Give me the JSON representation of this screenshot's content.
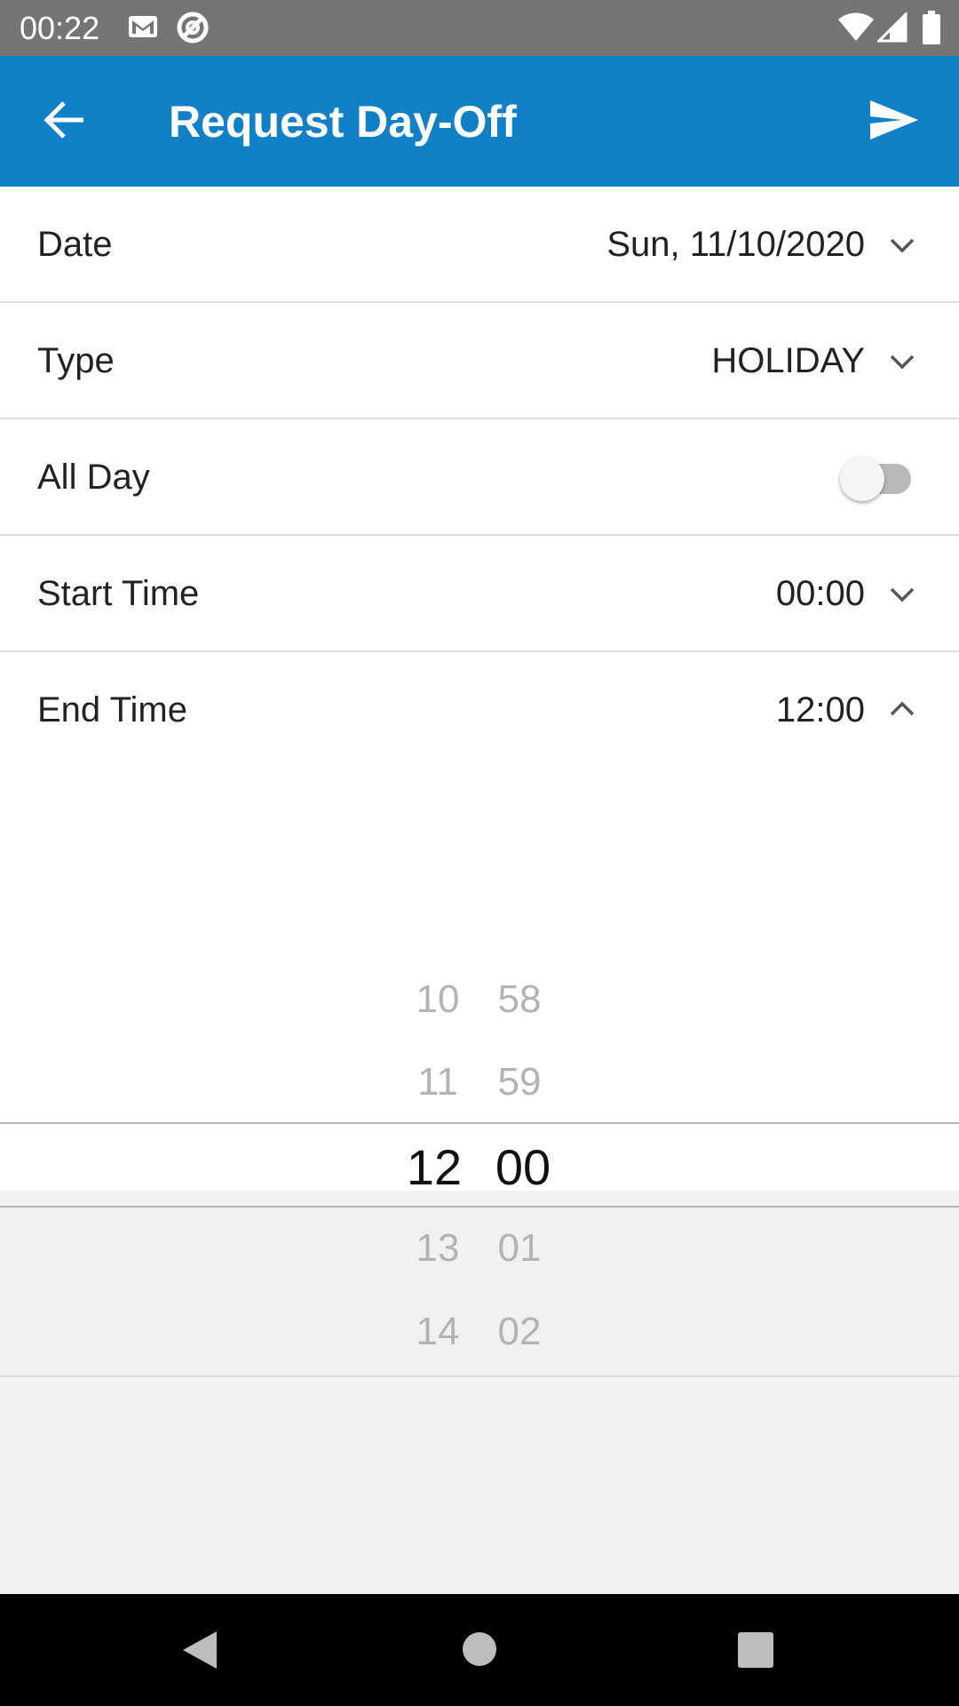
{
  "status_bar": {
    "time": "00:22",
    "icons": [
      "gmail-icon",
      "sync-disabled-icon",
      "wifi-icon",
      "signal-icon",
      "battery-icon"
    ]
  },
  "app_bar": {
    "title": "Request Day-Off",
    "back_icon": "arrow-back-icon",
    "send_icon": "send-icon",
    "color": "#1180c7"
  },
  "form": {
    "date": {
      "label": "Date",
      "value": "Sun, 11/10/2020"
    },
    "type": {
      "label": "Type",
      "value": "HOLIDAY"
    },
    "all_day": {
      "label": "All Day",
      "enabled": false
    },
    "start_time": {
      "label": "Start Time",
      "value": "00:00"
    },
    "end_time": {
      "label": "End Time",
      "value": "12:00"
    }
  },
  "time_picker": {
    "hours": [
      "10",
      "11",
      "12",
      "13",
      "14"
    ],
    "minutes": [
      "58",
      "59",
      "00",
      "01",
      "02"
    ],
    "selected_hour": "12",
    "selected_minute": "00"
  },
  "nav_bar": {
    "icons": [
      "back-triangle-icon",
      "home-circle-icon",
      "recents-square-icon"
    ]
  }
}
